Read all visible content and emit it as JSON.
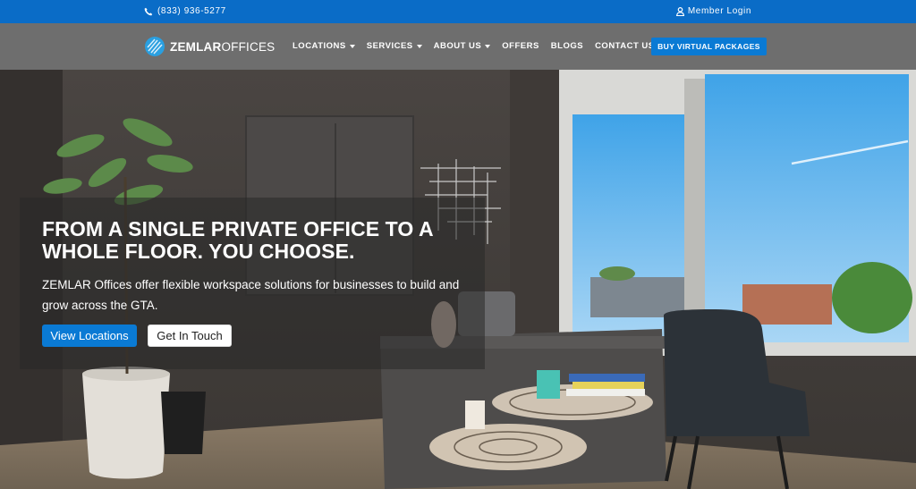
{
  "topbar": {
    "phone": "(833) 936-5277",
    "login": "Member Login"
  },
  "nav": {
    "logo_bold": "ZEMLAR",
    "logo_light": "OFFICES",
    "items": [
      {
        "label": "LOCATIONS",
        "dropdown": true
      },
      {
        "label": "SERVICES",
        "dropdown": true
      },
      {
        "label": "ABOUT US",
        "dropdown": true
      },
      {
        "label": "OFFERS",
        "dropdown": false
      },
      {
        "label": "BLOGS",
        "dropdown": false
      },
      {
        "label": "CONTACT US",
        "dropdown": false
      }
    ],
    "cta": "BUY VIRTUAL PACKAGES"
  },
  "hero": {
    "headline": "FROM A SINGLE PRIVATE OFFICE TO A WHOLE FLOOR. YOU CHOOSE.",
    "subtext": "ZEMLAR Offices offer flexible workspace solutions for businesses to build and grow across the GTA.",
    "primary_button": "View Locations",
    "secondary_button": "Get In Touch"
  },
  "colors": {
    "brand_blue": "#0a6cc7",
    "nav_gray": "#6e6e6e",
    "button_blue": "#0a7ad4"
  }
}
